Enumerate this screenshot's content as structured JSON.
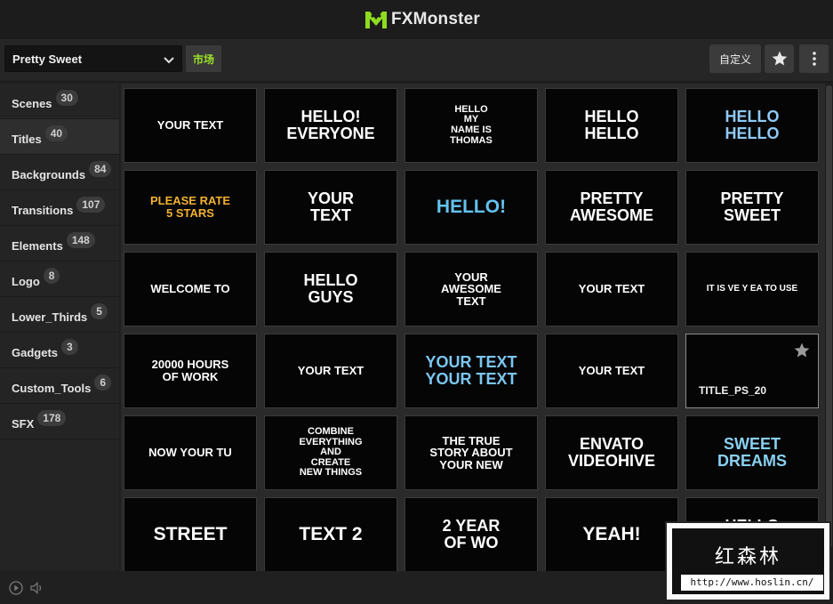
{
  "app": {
    "title": "FXMonster",
    "accent": "#8fdc1f"
  },
  "toolbar": {
    "preset_value": "Pretty Sweet",
    "market_label": "市场",
    "custom_label": "自定义"
  },
  "categories": [
    {
      "label": "Scenes",
      "count": "30"
    },
    {
      "label": "Titles",
      "count": "40",
      "active": true
    },
    {
      "label": "Backgrounds",
      "count": "84"
    },
    {
      "label": "Transitions",
      "count": "107"
    },
    {
      "label": "Elements",
      "count": "148"
    },
    {
      "label": "Logo",
      "count": "8"
    },
    {
      "label": "Lower_Thirds",
      "count": "5"
    },
    {
      "label": "Gadgets",
      "count": "3"
    },
    {
      "label": "Custom_Tools",
      "count": "6"
    },
    {
      "label": "SFX",
      "count": "178"
    }
  ],
  "tiles": [
    {
      "text": "YOUR TEXT",
      "color": "#ffffff"
    },
    {
      "text": "HELLO!\nEVERYONE",
      "color": "#ffffff"
    },
    {
      "text": "HELLO\nMY\nNAME IS\nTHOMAS",
      "color": "#ffffff"
    },
    {
      "text": "HELLO\nHELLO",
      "color": "#ffffff"
    },
    {
      "text": "HELLO\nHELLO",
      "color": "#8ec9f5"
    },
    {
      "text": "PLEASE RATE\n5 STARS",
      "color": "#f2b134"
    },
    {
      "text": "YOUR\nTEXT",
      "color": "#ffffff"
    },
    {
      "text": "HELLO!",
      "color": "#62c3ee"
    },
    {
      "text": "PRETTY\nAWESOME",
      "color": "#ffffff"
    },
    {
      "text": "PRETTY\nSWEET",
      "color": "#ffffff"
    },
    {
      "text": "WELCOME TO",
      "color": "#ffffff"
    },
    {
      "text": "HELLO\nGUYS",
      "color": "#ffffff"
    },
    {
      "text": "YOUR\nAWESOME\nTEXT",
      "color": "#ffffff"
    },
    {
      "text": "YOUR TEXT",
      "color": "#ffffff"
    },
    {
      "text": "IT IS VE Y EA     TO USE",
      "color": "#ffffff"
    },
    {
      "text": "20000 HOURS\nOF WORK",
      "color": "#ffffff"
    },
    {
      "text": "YOUR TEXT",
      "color": "#ffffff"
    },
    {
      "text": "YOUR TEXT\nYOUR TEXT",
      "color": "#7cc6f0"
    },
    {
      "text": "YOUR TEXT",
      "color": "#ffffff"
    },
    {
      "text": "",
      "color": "#ffffff",
      "name": "TITLE_PS_20",
      "selected": true
    },
    {
      "text": "NOW YOUR TU",
      "color": "#ffffff"
    },
    {
      "text": "COMBINE\nEVERYTHING\nAND\nCREATE\nNEW THINGS",
      "color": "#ffffff"
    },
    {
      "text": "THE TRUE\nSTORY ABOUT\nYOUR NEW",
      "color": "#ffffff"
    },
    {
      "text": "ENVATO\nVIDEOHIVE",
      "color": "#ffffff"
    },
    {
      "text": "SWEET\nDREAMS",
      "color": "#8ad0f2"
    },
    {
      "text": "STREET",
      "color": "#ffffff"
    },
    {
      "text": "TEXT 2",
      "color": "#ffffff"
    },
    {
      "text": "2 YEAR\nOF WO",
      "color": "#ffffff"
    },
    {
      "text": "YEAH!",
      "color": "#ffffff"
    },
    {
      "text": "HELLO\nEVERYONE",
      "color": "#ffffff"
    }
  ],
  "watermark": {
    "title": "红森林",
    "url": "http://www.hoslin.cn/"
  }
}
